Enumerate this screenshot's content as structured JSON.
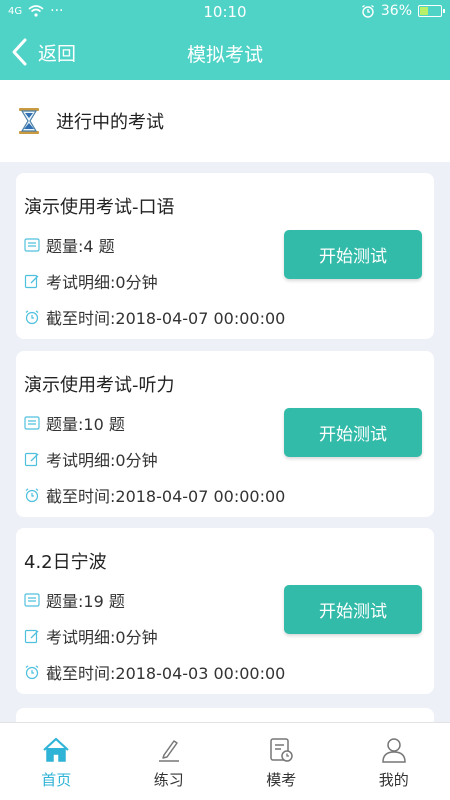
{
  "status_bar": {
    "signal": "4G",
    "dots": "···",
    "time": "10:10",
    "battery": "36%",
    "battery_level": 0.36,
    "alarm_icon": "alarm-icon"
  },
  "nav": {
    "back_label": "返回",
    "title": "模拟考试"
  },
  "section": {
    "title": "进行中的考试",
    "icon": "hourglass-icon"
  },
  "exams": [
    {
      "name": "演示使用考试-口语",
      "count": "题量:4 题",
      "detail": "考试明细:0分钟",
      "deadline": "截至时间:2018-04-07 00:00:00",
      "button": "开始测试"
    },
    {
      "name": "演示使用考试-听力",
      "count": "题量:10 题",
      "detail": "考试明细:0分钟",
      "deadline": "截至时间:2018-04-07 00:00:00",
      "button": "开始测试"
    },
    {
      "name": "4.2日宁波",
      "count": "题量:19 题",
      "detail": "考试明细:0分钟",
      "deadline": "截至时间:2018-04-03 00:00:00",
      "button": "开始测试"
    }
  ],
  "tabs": [
    {
      "label": "首页",
      "icon": "home-icon",
      "active": true
    },
    {
      "label": "练习",
      "icon": "pen-icon",
      "active": false
    },
    {
      "label": "模考",
      "icon": "exam-icon",
      "active": false
    },
    {
      "label": "我的",
      "icon": "user-icon",
      "active": false
    }
  ],
  "colors": {
    "accent": "#4fd3c7",
    "button": "#33bba9",
    "active_tab": "#2fb3d6",
    "background": "#eef0f8"
  }
}
